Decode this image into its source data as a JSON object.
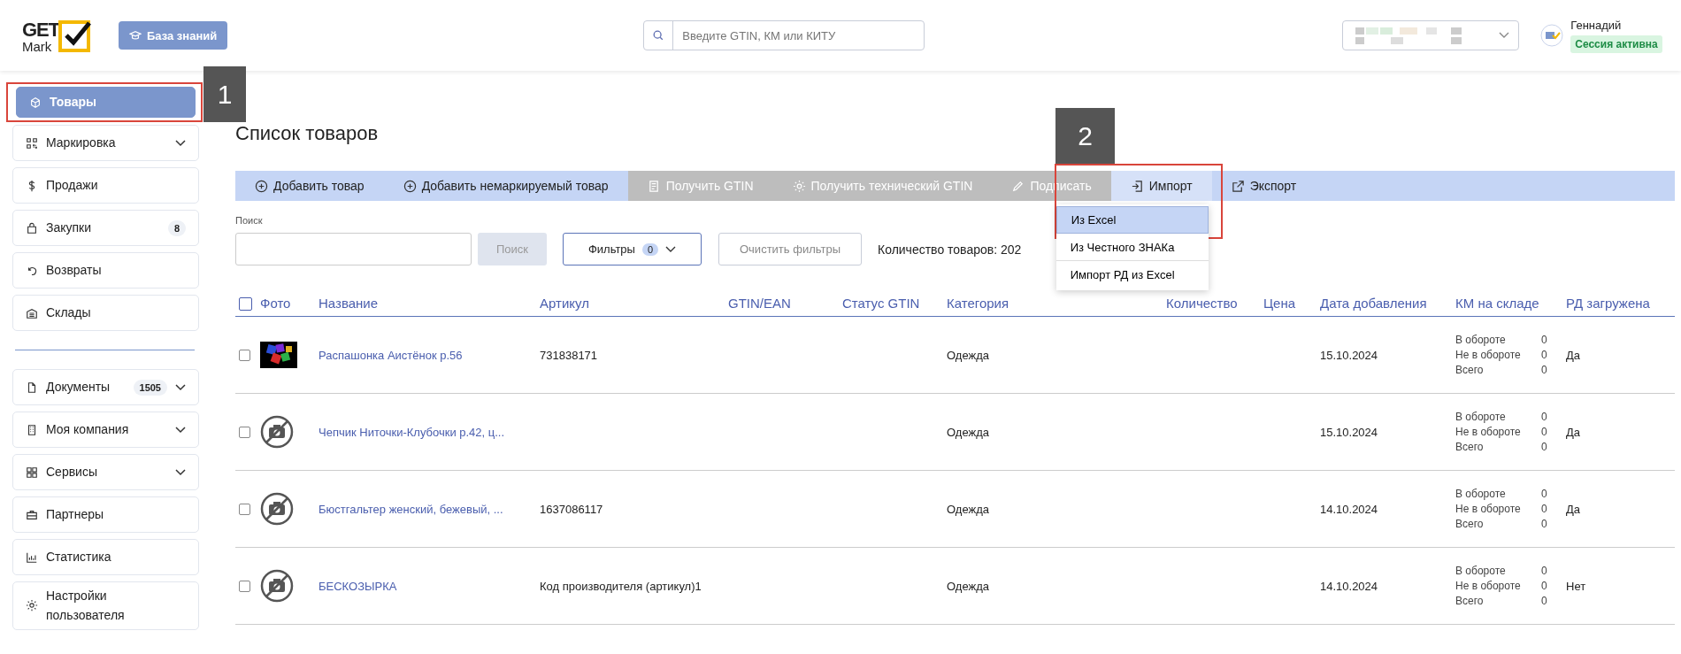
{
  "header": {
    "logo_top": "GET",
    "logo_bottom": "Mark",
    "kb_button": "База знаний",
    "search": {
      "placeholder": "Введите GTIN, КМ или КИТУ"
    },
    "user": {
      "name": "Геннадий",
      "status": "Сессия активна"
    }
  },
  "sidebar": {
    "groups": [
      [
        {
          "label": "Товары",
          "selected": true,
          "expandable": false
        },
        {
          "label": "Маркировка",
          "selected": false,
          "expandable": true
        },
        {
          "label": "Продажи",
          "selected": false,
          "expandable": false
        },
        {
          "label": "Закупки",
          "selected": false,
          "expandable": false,
          "badge": "8"
        },
        {
          "label": "Возвраты",
          "selected": false,
          "expandable": false
        },
        {
          "label": "Склады",
          "selected": false,
          "expandable": false
        }
      ],
      [
        {
          "label": "Документы",
          "selected": false,
          "expandable": true,
          "badge": "1505"
        },
        {
          "label": "Моя компания",
          "selected": false,
          "expandable": true
        },
        {
          "label": "Сервисы",
          "selected": false,
          "expandable": true
        },
        {
          "label": "Партнеры",
          "selected": false,
          "expandable": false
        },
        {
          "label": "Статистика",
          "selected": false,
          "expandable": false
        },
        {
          "label": "Настройки пользователя",
          "selected": false,
          "expandable": false
        }
      ]
    ]
  },
  "annotations": [
    "1",
    "2"
  ],
  "page_title": "Список товаров",
  "toolbar": [
    {
      "label": "Добавить товар",
      "disabled": false,
      "expanded": false
    },
    {
      "label": "Добавить немаркируемый товар",
      "disabled": false,
      "expanded": false
    },
    {
      "label": "Получить GTIN",
      "disabled": true,
      "expanded": false
    },
    {
      "label": "Получить технический GTIN",
      "disabled": true,
      "expanded": false
    },
    {
      "label": "Подписать",
      "disabled": true,
      "expanded": false
    },
    {
      "label": "Импорт",
      "disabled": false,
      "expanded": true,
      "menu": [
        {
          "label": "Из Excel",
          "selected": true
        },
        {
          "label": "Из Честного ЗНАКа",
          "selected": false
        },
        {
          "label": "Импорт РД из Excel",
          "selected": false
        }
      ]
    },
    {
      "label": "Экспорт",
      "disabled": false,
      "expanded": false
    }
  ],
  "filters": {
    "search_label": "Поиск",
    "search_button": "Поиск",
    "search_disabled": true,
    "filters_button": "Фильтры",
    "filters_count": "0",
    "clear_button": "Очистить фильтры",
    "count_text": "Количество товаров: 202"
  },
  "table": {
    "select_all": false,
    "columns": [
      "Фото",
      "Название",
      "Артикул",
      "GTIN/EAN",
      "Статус GTIN",
      "Категория",
      "Количество",
      "Цена",
      "Дата добавления",
      "КМ на складе",
      "РД загружена"
    ],
    "rows": [
      {
        "checked": false,
        "photo": {
          "kind": "picture"
        },
        "name": "Распашонка Аистёнок р.56",
        "article": "731838171",
        "category": "Одежда",
        "date": "15.10.2024",
        "km": [
          {
            "label": "В обороте",
            "value": "0"
          },
          {
            "label": "Не в обороте",
            "value": "0"
          },
          {
            "label": "Всего",
            "value": "0"
          }
        ],
        "rd": "Да"
      },
      {
        "checked": false,
        "photo": {
          "kind": "none"
        },
        "name": "Чепчик Ниточки-Клубочки р.42, ц...",
        "article": "",
        "category": "Одежда",
        "date": "15.10.2024",
        "km": [
          {
            "label": "В обороте",
            "value": "0"
          },
          {
            "label": "Не в обороте",
            "value": "0"
          },
          {
            "label": "Всего",
            "value": "0"
          }
        ],
        "rd": "Да"
      },
      {
        "checked": false,
        "photo": {
          "kind": "none"
        },
        "name": "Бюстгальтер женский, бежевый, ...",
        "article": "1637086117",
        "category": "Одежда",
        "date": "14.10.2024",
        "km": [
          {
            "label": "В обороте",
            "value": "0"
          },
          {
            "label": "Не в обороте",
            "value": "0"
          },
          {
            "label": "Всего",
            "value": "0"
          }
        ],
        "rd": "Да"
      },
      {
        "checked": false,
        "photo": {
          "kind": "none"
        },
        "name": "БЕСКОЗЫРКА",
        "article": "Код производителя (артикул)1",
        "category": "Одежда",
        "date": "14.10.2024",
        "km": [
          {
            "label": "В обороте",
            "value": "0"
          },
          {
            "label": "Не в обороте",
            "value": "0"
          },
          {
            "label": "Всего",
            "value": "0"
          }
        ],
        "rd": "Нет"
      }
    ]
  }
}
